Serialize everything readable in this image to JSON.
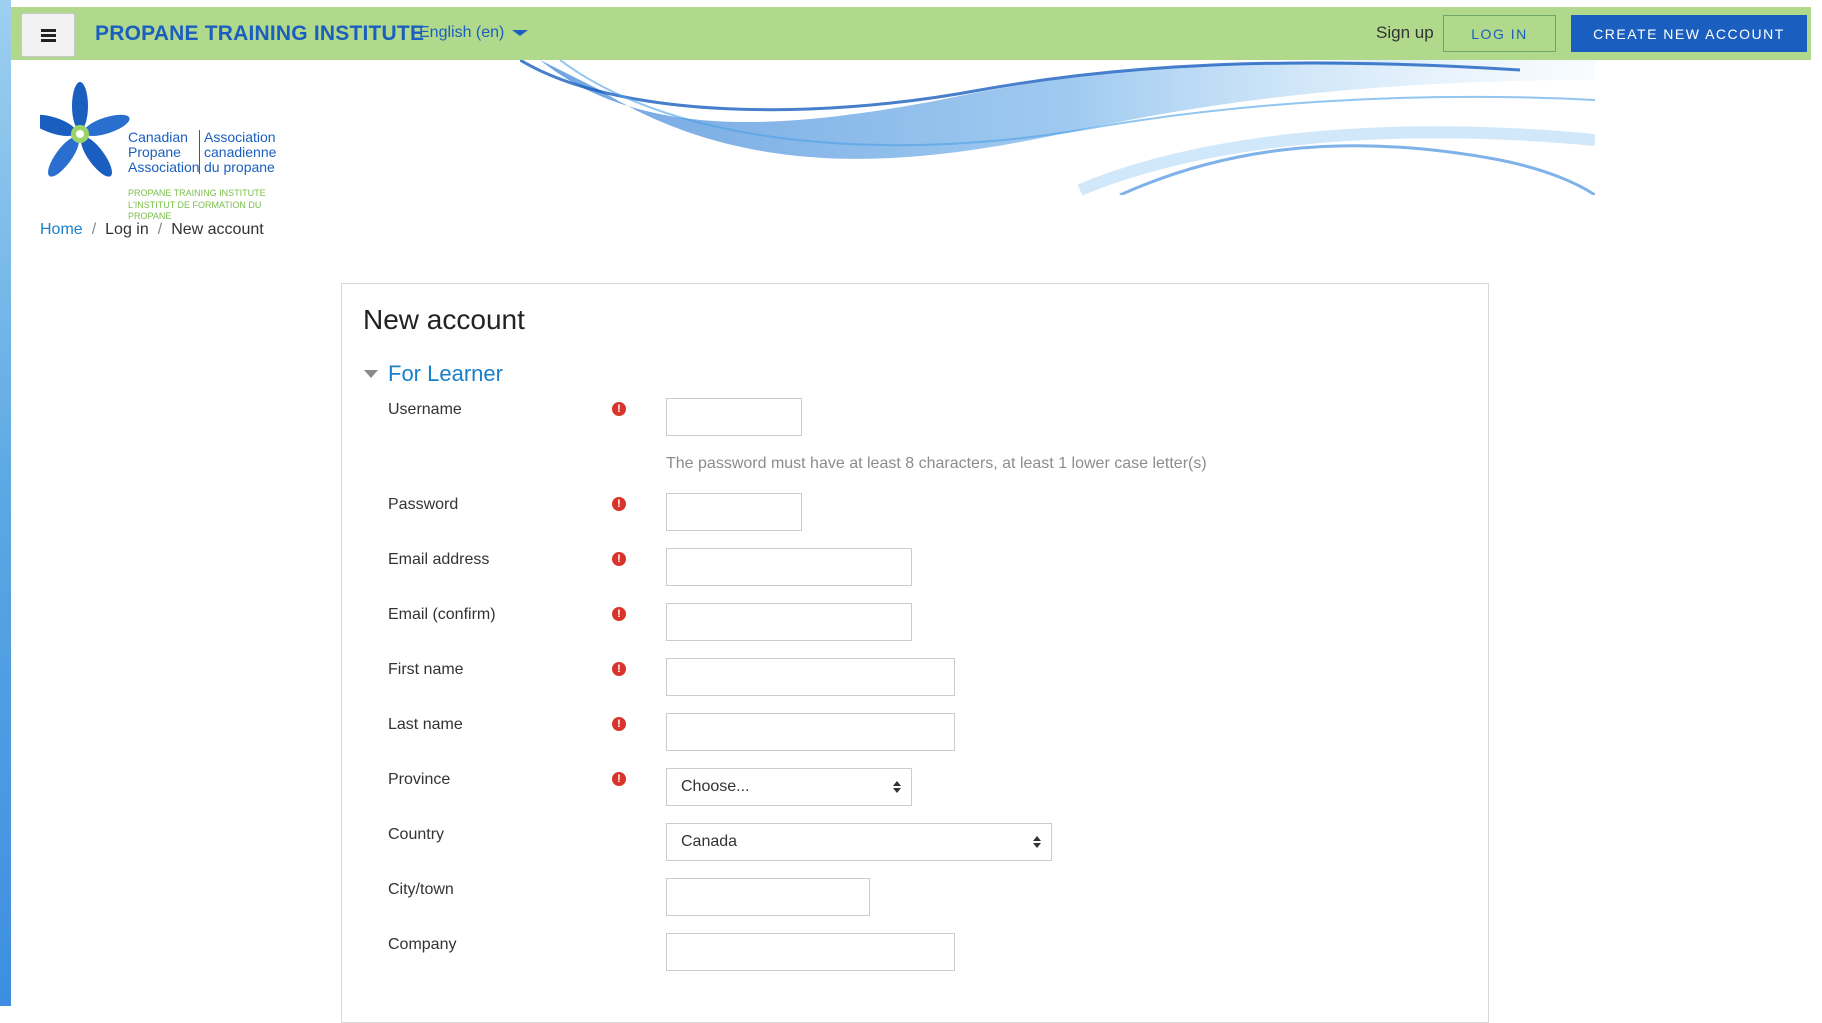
{
  "header": {
    "site_title": "PROPANE TRAINING INSTITUTE",
    "language": "English (en)",
    "signup_label": "Sign up",
    "login_label": "LOG IN",
    "create_account_label": "CREATE NEW ACCOUNT"
  },
  "logo": {
    "col1": [
      "Canadian",
      "Propane",
      "Association"
    ],
    "col2": [
      "Association",
      "canadienne",
      "du propane"
    ],
    "sub1": "PROPANE TRAINING INSTITUTE",
    "sub2": "L'INSTITUT DE FORMATION DU PROPANE"
  },
  "breadcrumb": {
    "home": "Home",
    "login": "Log in",
    "current": "New account",
    "separator": "/"
  },
  "form": {
    "title": "New account",
    "section": "For Learner",
    "password_hint": "The password must have at least 8 characters, at least 1 lower case letter(s)",
    "fields": {
      "username": "Username",
      "password": "Password",
      "email": "Email address",
      "email_confirm": "Email (confirm)",
      "first_name": "First name",
      "last_name": "Last name",
      "province": "Province",
      "country": "Country",
      "city": "City/town",
      "company": "Company"
    },
    "province_value": "Choose...",
    "country_value": "Canada",
    "required_icon": "!"
  },
  "colors": {
    "topbar": "#b0d98b",
    "brand_blue": "#1a5fbf",
    "link_blue": "#1a80c8",
    "required_red": "#d9342b"
  }
}
